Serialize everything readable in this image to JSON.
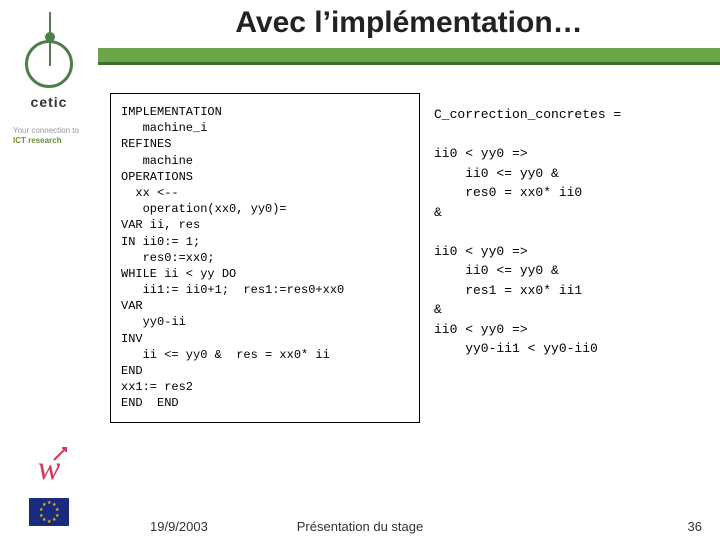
{
  "brand": {
    "name": "cetic",
    "tagline_line1": "Your connection to",
    "tagline_line2": "ICT research"
  },
  "title": "Avec l’implémentation…",
  "code": "IMPLEMENTATION\n   machine_i\nREFINES\n   machine\nOPERATIONS\n  xx <--\n   operation(xx0, yy0)=\nVAR ii, res\nIN ii0:= 1;\n   res0:=xx0;\nWHILE ii < yy DO\n   ii1:= ii0+1;  res1:=res0+xx0\nVAR\n   yy0-ii\nINV\n   ii <= yy0 &  res = xx0* ii\nEND\nxx1:= res2\nEND  END",
  "right": "C_correction_concretes =\n\nii0 < yy0 =>\n    ii0 <= yy0 &\n    res0 = xx0* ii0\n&\n\nii0 < yy0 =>\n    ii0 <= yy0 &\n    res1 = xx0* ii1\n&\nii0 < yy0 =>\n    yy0-ii1 < yy0-ii0",
  "footer": {
    "date": "19/9/2003",
    "center": "Présentation du stage",
    "page": "36"
  }
}
